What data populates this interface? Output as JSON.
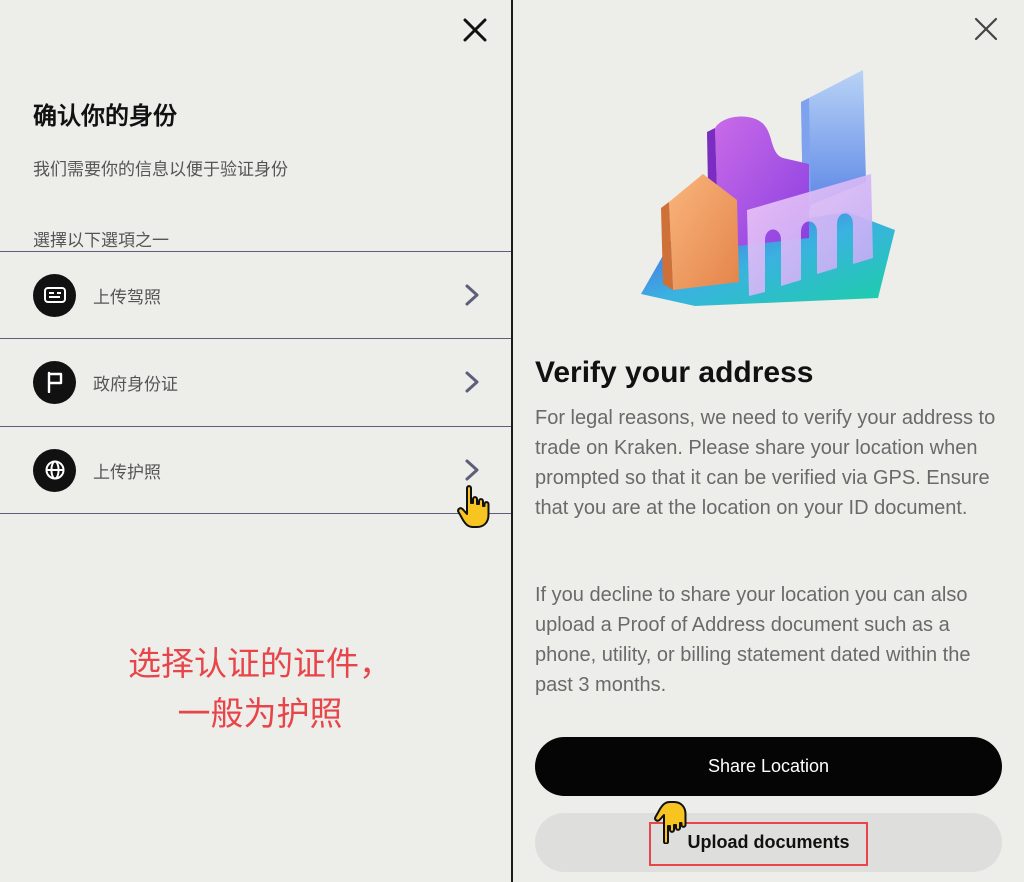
{
  "left": {
    "title": "确认你的身份",
    "subtitle": "我们需要你的信息以便于验证身份",
    "section_label": "選擇以下選項之一",
    "options": [
      {
        "label": "上传驾照",
        "icon": "id-card-icon"
      },
      {
        "label": "政府身份证",
        "icon": "flag-icon"
      },
      {
        "label": "上传护照",
        "icon": "globe-icon"
      }
    ],
    "annotation_line1": "选择认证的证件，",
    "annotation_line2": "一般为护照"
  },
  "right": {
    "heading": "Verify your address",
    "paragraph1": "For legal reasons, we need to verify your address to trade on Kraken. Please share your location when prompted so that it can be verified via GPS. Ensure that you are at the location on your ID document.",
    "paragraph2": "If you decline to share your location you can also upload a Proof of Address document such as a phone, utility, or billing statement dated within the past 3 months.",
    "share_button": "Share Location",
    "upload_button": "Upload documents"
  },
  "colors": {
    "annotation": "#e8454a",
    "primary_button": "#050505",
    "secondary_button": "#dededc",
    "background": "#ededea"
  }
}
